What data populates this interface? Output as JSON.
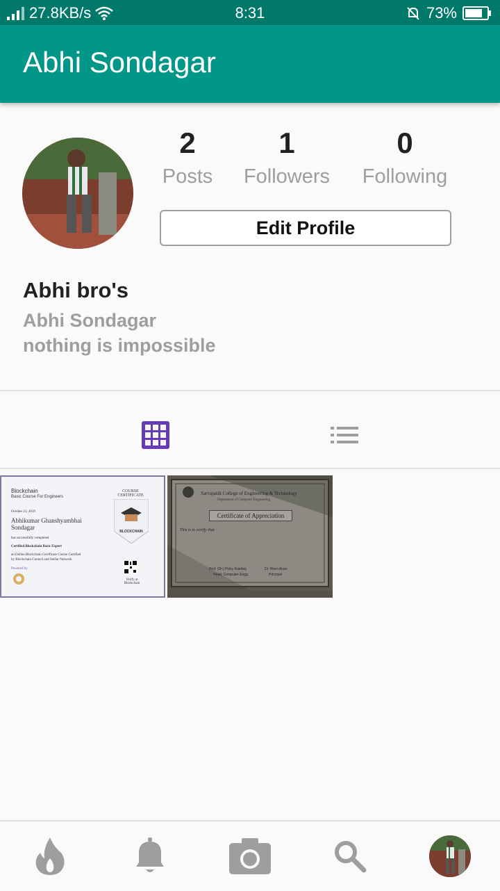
{
  "status": {
    "speed": "27.8KB/s",
    "time": "8:31",
    "battery": "73%"
  },
  "appbar": {
    "title": "Abhi Sondagar"
  },
  "profile": {
    "stats": [
      {
        "value": "2",
        "label": "Posts"
      },
      {
        "value": "1",
        "label": "Followers"
      },
      {
        "value": "0",
        "label": "Following"
      }
    ],
    "edit_label": "Edit Profile",
    "display_name": "Abhi bro's",
    "username": "Abhi Sondagar",
    "bio": "nothing is impossible"
  },
  "tabs": {
    "grid_icon": "grid-icon",
    "list_icon": "list-icon",
    "active_color": "#673ab7"
  },
  "posts": [
    {
      "title": "Blockchain",
      "subtitle": "Basic Course For Engineers",
      "badge": "COURSE CERTIFICATE",
      "date": "October 21, 2019",
      "name": "Abhikumar Ghanshyambhai Sondagar",
      "line1": "has successfully completed",
      "line2": "Certified Blockchain Basic Expert",
      "line3": "an Online Blockchain Certificate Course Certified",
      "line4": "by Blockchain Council and Stellar Network",
      "powered": "Powered by",
      "logo": "BLOCKCHAIN",
      "verify": "Verify at Blockchain"
    },
    {
      "college": "Sarvajanik College of Engineering & Technology",
      "dept": "Department of Computer Engineering",
      "title": "Certificate of Appreciation",
      "body": "This is to certify that",
      "sign1": "Prof. (Dr.) Pinky Kamboj",
      "sign1b": "Head, Computer Engg.",
      "sign2": "Dr. Hiren Anan",
      "sign2b": "Principal"
    }
  ],
  "nav": [
    "flame-icon",
    "bell-icon",
    "camera-icon",
    "search-icon",
    "profile-avatar"
  ],
  "colors": {
    "primary": "#009688",
    "primary_dark": "#00796b",
    "muted": "#9e9e9e"
  }
}
